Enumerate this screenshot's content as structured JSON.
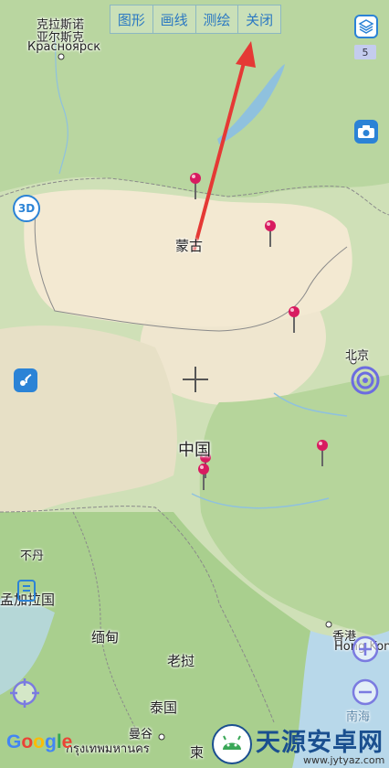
{
  "toolbar": {
    "tabs": [
      "图形",
      "画线",
      "测绘",
      "关闭"
    ]
  },
  "layers": {
    "count": "5"
  },
  "buttons": {
    "mode3d": "3D"
  },
  "map_labels": {
    "krasnoyarsk_cn1": "克拉斯诺",
    "krasnoyarsk_cn2": "亚尔斯克",
    "krasnoyarsk_ru": "Красноярск",
    "mongolia": "蒙古",
    "beijing": "北京",
    "china": "中国",
    "bhutan": "不丹",
    "bangladesh": "孟加拉国",
    "myanmar": "缅甸",
    "laos": "老挝",
    "hongkong_cn": "香港",
    "hongkong_en": "Hong Kong",
    "thailand": "泰国",
    "bangkok_cn": "曼谷",
    "bangkok_th": "กรุงเทพมหานคร",
    "cambodia": "柬",
    "southsea": "南海"
  },
  "attribution": {
    "google": [
      "G",
      "o",
      "o",
      "g",
      "l",
      "e"
    ]
  },
  "watermark": {
    "title": "天源安卓网",
    "url": "www.jytyaz.com"
  },
  "colors": {
    "accent": "#2b83d6",
    "arrow": "#e53935",
    "pin": "#d81b60"
  }
}
